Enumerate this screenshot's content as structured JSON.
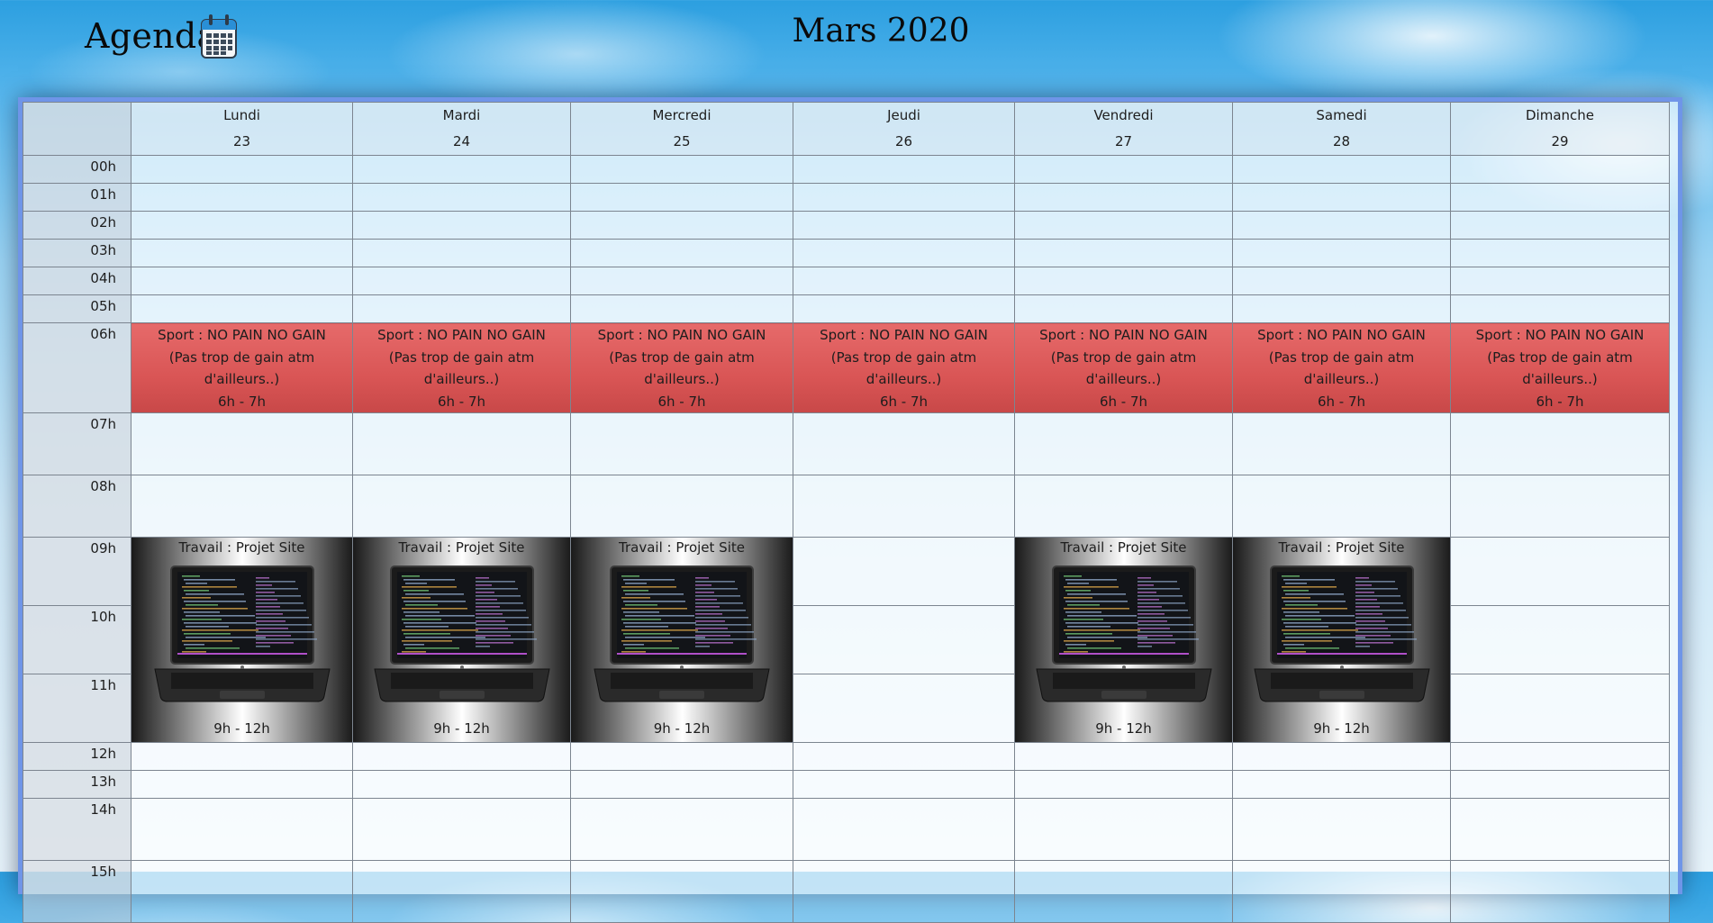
{
  "header": {
    "app_title": "Agenda",
    "month_title": "Mars 2020",
    "icon": "calendar-icon"
  },
  "days": [
    {
      "name": "Lundi",
      "date": "23"
    },
    {
      "name": "Mardi",
      "date": "24"
    },
    {
      "name": "Mercredi",
      "date": "25"
    },
    {
      "name": "Jeudi",
      "date": "26"
    },
    {
      "name": "Vendredi",
      "date": "27"
    },
    {
      "name": "Samedi",
      "date": "28"
    },
    {
      "name": "Dimanche",
      "date": "29"
    }
  ],
  "hours": [
    "00h",
    "01h",
    "02h",
    "03h",
    "04h",
    "05h",
    "06h",
    "07h",
    "08h",
    "09h",
    "10h",
    "11h",
    "12h",
    "13h",
    "14h",
    "15h"
  ],
  "events": {
    "sport": {
      "title": "Sport : NO PAIN NO GAIN",
      "subtitle": "(Pas trop de gain atm d'ailleurs..)",
      "time": "6h - 7h",
      "days": [
        0,
        1,
        2,
        3,
        4,
        5,
        6
      ],
      "color": "#dc5a5a"
    },
    "work": {
      "title": "Travail : Projet Site",
      "time": "9h - 12h",
      "days": [
        0,
        1,
        2,
        4,
        5
      ]
    }
  },
  "colors": {
    "frame_border": "#6f95e8",
    "sky": "#5ab8ee"
  }
}
